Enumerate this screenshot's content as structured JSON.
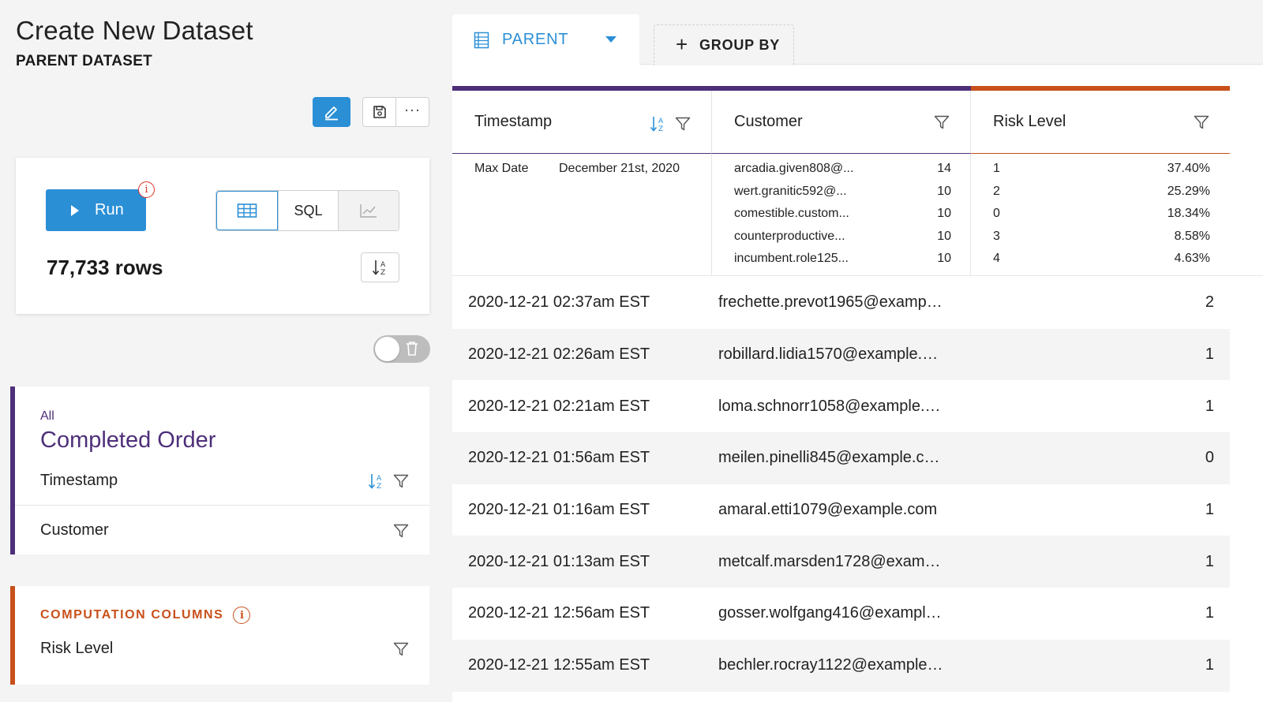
{
  "header": {
    "title": "Create New Dataset",
    "subtitle": "PARENT DATASET"
  },
  "toolbar": {
    "edit_icon": "pencil-icon",
    "save_icon": "save-icon",
    "more_label": "···"
  },
  "run_card": {
    "run_label": "Run",
    "info_label": "i",
    "view_options": [
      {
        "name": "table-view",
        "label": "",
        "icon": "table-icon",
        "active": true
      },
      {
        "name": "sql-view",
        "label": "SQL",
        "active": false
      },
      {
        "name": "chart-view",
        "label": "",
        "icon": "chart-icon",
        "active": false,
        "disabled": true
      }
    ],
    "row_count": "77,733 rows"
  },
  "event_card": {
    "scope": "All",
    "name": "Completed Order",
    "fields": [
      {
        "label": "Timestamp",
        "sortable": true
      },
      {
        "label": "Customer",
        "sortable": false
      }
    ]
  },
  "computation": {
    "title": "COMPUTATION COLUMNS",
    "info_label": "i",
    "fields": [
      {
        "label": "Risk Level"
      }
    ]
  },
  "tabs": {
    "parent_label": "PARENT",
    "group_by_label": "GROUP BY",
    "group_by_plus": "+"
  },
  "colors": {
    "accent_blue": "#2b8fd6",
    "event_purple": "#4e2f7a",
    "computation_orange": "#c8501b"
  },
  "table": {
    "columns": [
      "Timestamp",
      "Customer",
      "Risk Level"
    ],
    "summary": {
      "timestamp": {
        "label": "Max Date",
        "value": "December 21st, 2020"
      },
      "customer": [
        {
          "name": "arcadia.given808@...",
          "count": "14"
        },
        {
          "name": "wert.granitic592@...",
          "count": "10"
        },
        {
          "name": "comestible.custom...",
          "count": "10"
        },
        {
          "name": "counterproductive...",
          "count": "10"
        },
        {
          "name": "incumbent.role125...",
          "count": "10"
        }
      ],
      "risk": [
        {
          "level": "1",
          "pct": "37.40%"
        },
        {
          "level": "2",
          "pct": "25.29%"
        },
        {
          "level": "0",
          "pct": "18.34%"
        },
        {
          "level": "3",
          "pct": "8.58%"
        },
        {
          "level": "4",
          "pct": "4.63%"
        }
      ]
    },
    "rows": [
      {
        "timestamp": "2020-12-21 02:37am EST",
        "customer": "frechette.prevot1965@examp…",
        "risk": "2"
      },
      {
        "timestamp": "2020-12-21 02:26am EST",
        "customer": "robillard.lidia1570@example.…",
        "risk": "1"
      },
      {
        "timestamp": "2020-12-21 02:21am EST",
        "customer": "loma.schnorr1058@example.…",
        "risk": "1"
      },
      {
        "timestamp": "2020-12-21 01:56am EST",
        "customer": "meilen.pinelli845@example.c…",
        "risk": "0"
      },
      {
        "timestamp": "2020-12-21 01:16am EST",
        "customer": "amaral.etti1079@example.com",
        "risk": "1"
      },
      {
        "timestamp": "2020-12-21 01:13am EST",
        "customer": "metcalf.marsden1728@exam…",
        "risk": "1"
      },
      {
        "timestamp": "2020-12-21 12:56am EST",
        "customer": "gosser.wolfgang416@exampl…",
        "risk": "1"
      },
      {
        "timestamp": "2020-12-21 12:55am EST",
        "customer": "bechler.rocray1122@example…",
        "risk": "1"
      }
    ]
  }
}
